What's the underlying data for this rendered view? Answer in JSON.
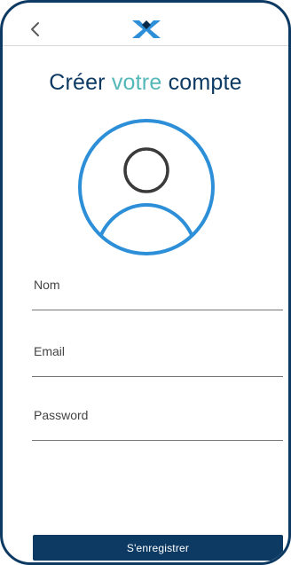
{
  "colors": {
    "primary": "#0d3a63",
    "accent": "#55b8b8",
    "avatar_ring": "#2d8fd8"
  },
  "header": {
    "back_icon": "chevron-left-icon",
    "logo_icon": "x-diamond-logo"
  },
  "title": {
    "part1": "Créer ",
    "highlight": "votre",
    "part2": " compte"
  },
  "avatar": {
    "icon": "user-avatar-icon"
  },
  "form": {
    "name_label": "Nom",
    "email_label": "Email",
    "password_label": "Password",
    "submit_label": "S'enregistrer"
  }
}
